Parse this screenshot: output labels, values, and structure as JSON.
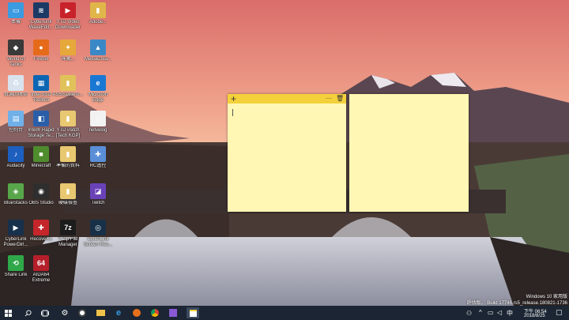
{
  "desktop_icons": [
    {
      "label": "本機",
      "color": "#3a9be0",
      "glyph": "▭"
    },
    {
      "label": "CyberLink\nWaveEdit...",
      "color": "#1d3a66",
      "glyph": "≋"
    },
    {
      "label": "YTD Video\nDownloader",
      "color": "#c8222a",
      "glyph": "▶"
    },
    {
      "label": "Adobe...",
      "color": "#e0b64a",
      "glyph": "▮"
    },
    {
      "label": "World of\nTanks",
      "color": "#3a3a3a",
      "glyph": "◆"
    },
    {
      "label": "Firefox",
      "color": "#e56a1a",
      "glyph": "●"
    },
    {
      "label": "神魔...",
      "color": "#e6a83a",
      "glyph": "✦"
    },
    {
      "label": "MediaCrea...",
      "color": "#3b88c7",
      "glyph": "▲"
    },
    {
      "label": "資源回收筒",
      "color": "#d8e3ee",
      "glyph": "♻"
    },
    {
      "label": "Intel SSD\nToolbox",
      "color": "#0d66b3",
      "glyph": "▦"
    },
    {
      "label": "ASSSDBenc...",
      "color": "#e0c25a",
      "glyph": "▮"
    },
    {
      "label": "Microsoft\nEdge",
      "color": "#1a78d4",
      "glyph": "e"
    },
    {
      "label": "控制台",
      "color": "#6fb0e8",
      "glyph": "▤"
    },
    {
      "label": "Intel® Rapid\nStorage Te...",
      "color": "#2a5ea8",
      "glyph": "◧"
    },
    {
      "label": "YTD Patch\n[Tech KGP]",
      "color": "#e8c870",
      "glyph": "▮"
    },
    {
      "label": "netvelog",
      "color": "#f2f2f2",
      "glyph": "▯"
    },
    {
      "label": "Audacity",
      "color": "#1d5fbf",
      "glyph": "♪"
    },
    {
      "label": "Minecraft",
      "color": "#4f8c2e",
      "glyph": "■"
    },
    {
      "label": "準備的資料",
      "color": "#e8c870",
      "glyph": "▮"
    },
    {
      "label": "RC遙控",
      "color": "#5a8fd8",
      "glyph": "✚"
    },
    {
      "label": "BlueStacks",
      "color": "#58a64a",
      "glyph": "◈"
    },
    {
      "label": "OBS Studio",
      "color": "#2e2e2e",
      "glyph": "◉"
    },
    {
      "label": "硬碟檢查",
      "color": "#e8c870",
      "glyph": "▮"
    },
    {
      "label": "Twitch",
      "color": "#6a42b8",
      "glyph": "◪"
    },
    {
      "label": "CyberLink\nPowerDirl...",
      "color": "#17314d",
      "glyph": "▶"
    },
    {
      "label": "RecoveRx",
      "color": "#c4262b",
      "glyph": "✚"
    },
    {
      "label": "7-Zip File\nManager",
      "color": "#1c1c1c",
      "glyph": "7z"
    },
    {
      "label": "CyberLink\nScreen Rec...",
      "color": "#173048",
      "glyph": "◎"
    },
    {
      "label": "Share Link",
      "color": "#2fa84a",
      "glyph": "⟲"
    },
    {
      "label": "AIDA64\nExtreme",
      "color": "#b41f2a",
      "glyph": "64"
    }
  ],
  "sticky_notes": {
    "add_glyph": "+",
    "menu_glyph": "···",
    "delete_glyph": "🗑"
  },
  "watermark": {
    "line1": "Windows 10 家用版",
    "line2": "評估版。 Build 17746.rs5_release.180821-1736"
  },
  "taskbar": {
    "time": "下午 06:54",
    "date": "2018/8/25"
  },
  "colors": {
    "note_body": "#fff7b3",
    "note_header": "#f4d13b",
    "taskbar": "#1b2533"
  }
}
